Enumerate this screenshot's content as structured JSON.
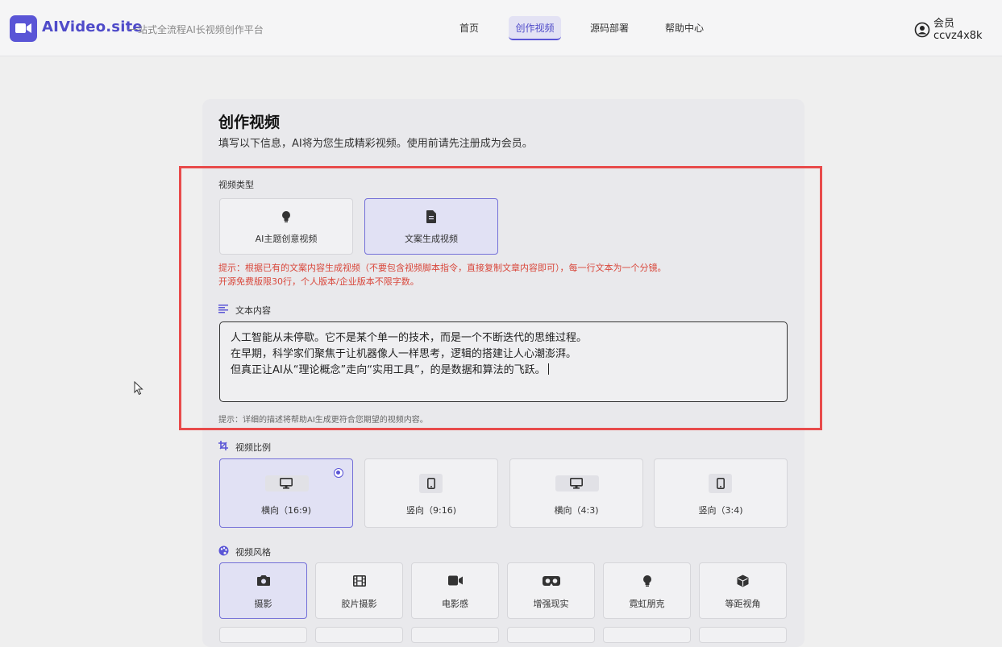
{
  "header": {
    "brand": "AIVideo.site",
    "slogan": "一站式全流程AI长视频创作平台",
    "nav": [
      "首页",
      "创作视频",
      "源码部署",
      "帮助中心"
    ],
    "active_nav": "创作视频",
    "user_line1": "会员",
    "user_line2": "ccvz4x8k"
  },
  "page": {
    "title": "创作视频",
    "subtitle": "填写以下信息，AI将为您生成精彩视频。使用前请先注册成为会员。"
  },
  "video_type": {
    "label": "视频类型",
    "options": [
      {
        "label": "AI主题创意视频",
        "icon": "lightbulb-icon",
        "selected": false
      },
      {
        "label": "文案生成视频",
        "icon": "document-icon",
        "selected": true
      }
    ],
    "hint_line1": "提示：根据已有的文案内容生成视频（不要包含视频脚本指令，直接复制文章内容即可），每一行文本为一个分镜。",
    "hint_line2": "开源免费版限30行，个人版本/企业版本不限字数。"
  },
  "text_content": {
    "label": "文本内容",
    "lines": [
      "人工智能从未停歇。它不是某个单一的技术，而是一个不断迭代的思维过程。",
      "在早期，科学家们聚焦于让机器像人一样思考，逻辑的搭建让人心潮澎湃。",
      "但真正让AI从“理论概念”走向“实用工具”，的是数据和算法的飞跃。"
    ],
    "hint": "提示：详细的描述将帮助AI生成更符合您期望的视频内容。"
  },
  "aspect_ratio": {
    "label": "视频比例",
    "options": [
      {
        "label": "横向（16:9)",
        "icon": "monitor-icon",
        "selected": true
      },
      {
        "label": "竖向（9:16)",
        "icon": "phone-icon",
        "selected": false
      },
      {
        "label": "横向（4:3)",
        "icon": "monitor-icon",
        "selected": false
      },
      {
        "label": "竖向（3:4)",
        "icon": "phone-icon",
        "selected": false
      }
    ]
  },
  "video_style": {
    "label": "视频风格",
    "options": [
      {
        "label": "摄影",
        "icon": "camera-icon",
        "selected": true
      },
      {
        "label": "胶片摄影",
        "icon": "film-icon",
        "selected": false
      },
      {
        "label": "电影感",
        "icon": "video-camera-icon",
        "selected": false
      },
      {
        "label": "增强现实",
        "icon": "vr-goggles-icon",
        "selected": false
      },
      {
        "label": "霓虹朋克",
        "icon": "lightbulb-icon",
        "selected": false
      },
      {
        "label": "等距视角",
        "icon": "cube-icon",
        "selected": false
      }
    ]
  },
  "colors": {
    "accent": "#5a55d6",
    "highlight_border": "#e84b4b",
    "hint_red": "#d9473b"
  }
}
